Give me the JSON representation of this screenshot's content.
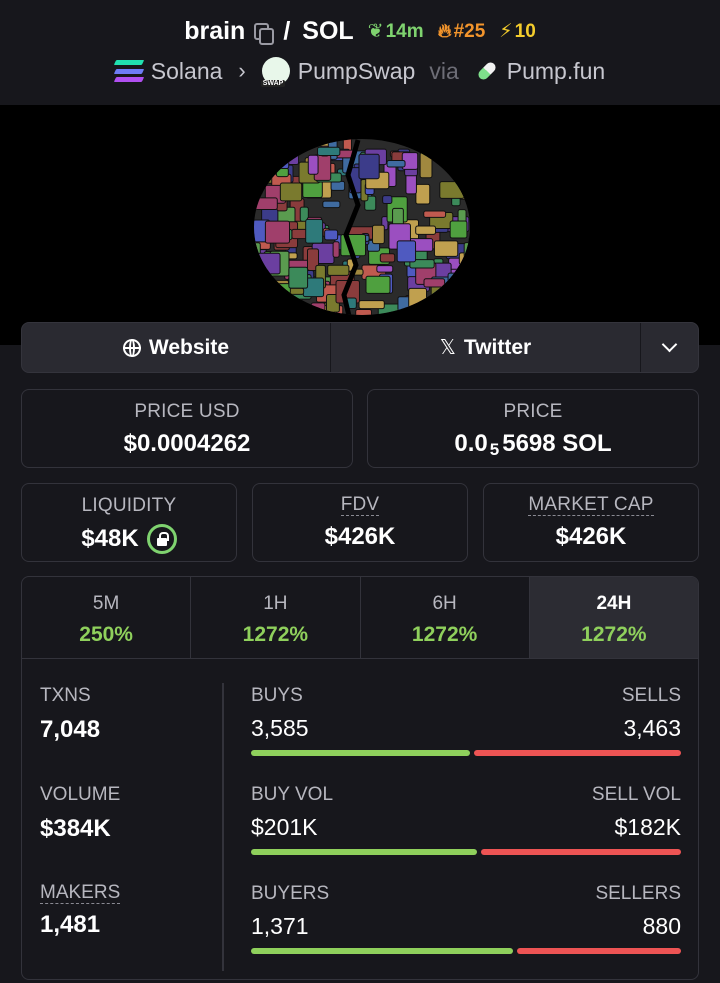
{
  "header": {
    "token": "brain",
    "separator": "/",
    "quote": "SOL",
    "age": "14m",
    "rank": "#25",
    "boosts": "10",
    "chain": "Solana",
    "dex": "PumpSwap",
    "via": "via",
    "launchpad": "Pump.fun"
  },
  "links": {
    "website": "Website",
    "twitter": "Twitter"
  },
  "prices": {
    "usd_label": "PRICE USD",
    "usd_value": "$0.0004262",
    "sol_label": "PRICE",
    "sol_prefix": "0.0",
    "sol_zeros": "5",
    "sol_suffix": "5698 SOL"
  },
  "market": {
    "liquidity_label": "LIQUIDITY",
    "liquidity_value": "$48K",
    "fdv_label": "FDV",
    "fdv_value": "$426K",
    "mcap_label": "MARKET CAP",
    "mcap_value": "$426K"
  },
  "tabs": [
    {
      "label": "5M",
      "value": "250%"
    },
    {
      "label": "1H",
      "value": "1272%"
    },
    {
      "label": "6H",
      "value": "1272%"
    },
    {
      "label": "24H",
      "value": "1272%"
    }
  ],
  "active_tab": "24H",
  "metrics": {
    "txns_label": "TXNS",
    "txns_value": "7,048",
    "buys_label": "BUYS",
    "buys_value": "3,585",
    "sells_label": "SELLS",
    "sells_value": "3,463",
    "buys_fraction": 0.509,
    "volume_label": "VOLUME",
    "volume_value": "$384K",
    "buyvol_label": "BUY VOL",
    "buyvol_value": "$201K",
    "sellvol_label": "SELL VOL",
    "sellvol_value": "$182K",
    "buyvol_fraction": 0.525,
    "makers_label": "MAKERS",
    "makers_value": "1,481",
    "buyers_label": "BUYERS",
    "buyers_value": "1,371",
    "sellers_label": "SELLERS",
    "sellers_value": "880",
    "buyers_fraction": 0.609
  },
  "colors": {
    "background": "#17171c",
    "positive": "#8fd05c",
    "negative": "#ee5454",
    "age": "#7fd36f",
    "rank": "#f3952c",
    "boost": "#f3cc2c"
  }
}
